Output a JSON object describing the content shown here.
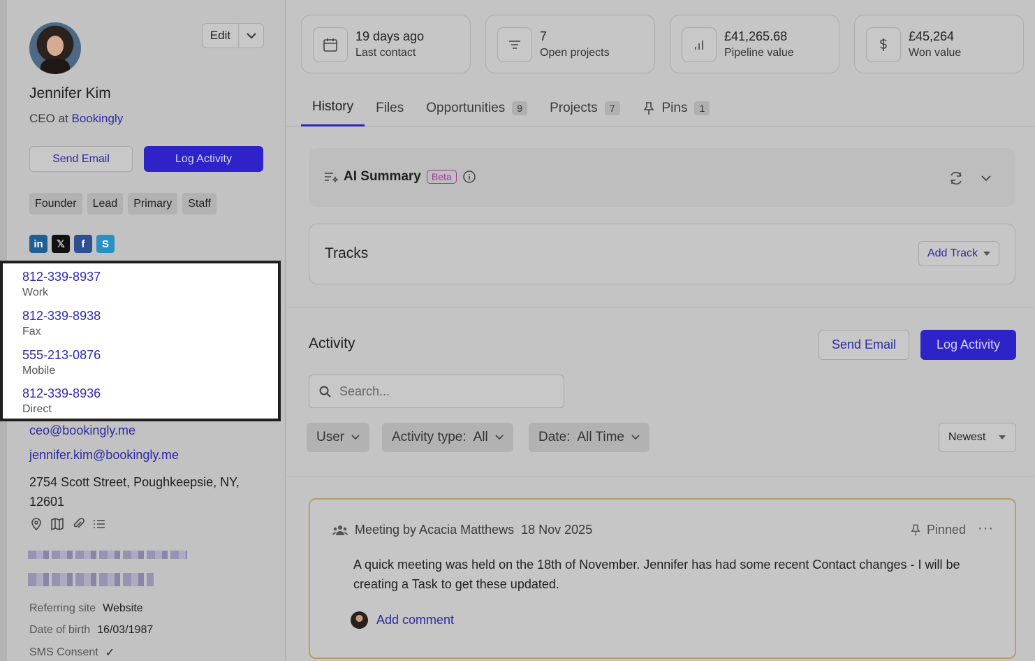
{
  "contact": {
    "name": "Jennifer Kim",
    "role_prefix": "CEO at",
    "company": "Bookingly",
    "edit_label": "Edit",
    "send_email": "Send Email",
    "log_activity": "Log Activity",
    "tags": [
      "Founder",
      "Lead",
      "Primary",
      "Staff"
    ],
    "phones": [
      {
        "number": "812-339-8937",
        "label": "Work"
      },
      {
        "number": "812-339-8938",
        "label": "Fax"
      },
      {
        "number": "555-213-0876",
        "label": "Mobile"
      },
      {
        "number": "812-339-8936",
        "label": "Direct"
      }
    ],
    "emails": [
      "ceo@bookingly.me",
      "jennifer.kim@bookingly.me"
    ],
    "address": "2754 Scott Street, Poughkeepsie, NY, 12601",
    "fields": [
      {
        "key": "Referring site",
        "value": "Website"
      },
      {
        "key": "Date of birth",
        "value": "16/03/1987"
      },
      {
        "key": "SMS Consent",
        "value": "✓"
      }
    ]
  },
  "stats": [
    {
      "value": "19 days ago",
      "label": "Last contact",
      "icon": "calendar-icon"
    },
    {
      "value": "7",
      "label": "Open projects",
      "icon": "list-icon"
    },
    {
      "value": "£41,265.68",
      "label": "Pipeline value",
      "icon": "bar-chart-icon"
    },
    {
      "value": "£45,264",
      "label": "Won value",
      "icon": "dollar-icon"
    }
  ],
  "tabs": [
    {
      "label": "History",
      "count": ""
    },
    {
      "label": "Files",
      "count": ""
    },
    {
      "label": "Opportunities",
      "count": "9"
    },
    {
      "label": "Projects",
      "count": "7"
    },
    {
      "label": "Pins",
      "count": "1"
    }
  ],
  "ai_summary": {
    "title": "AI Summary",
    "badge": "Beta"
  },
  "tracks": {
    "title": "Tracks",
    "add_label": "Add Track"
  },
  "activity": {
    "title": "Activity",
    "send_email": "Send Email",
    "log_activity": "Log Activity",
    "search_placeholder": "Search...",
    "filters": {
      "user": "User",
      "type_key": "Activity type:",
      "type_value": "All",
      "date_key": "Date:",
      "date_value": "All Time"
    },
    "sort": "Newest"
  },
  "meeting": {
    "title": "Meeting by Acacia Matthews",
    "date": "18 Nov 2025",
    "pinned": "Pinned",
    "body": "A quick meeting was held on the 18th of November. Jennifer has had some recent Contact changes - I will be creating a Task to get these updated.",
    "add_comment": "Add comment"
  },
  "colors": {
    "accent": "#2d23c8",
    "link": "#2c2aa3",
    "pinned_border": "#b69f63",
    "beta": "#a0389a"
  }
}
